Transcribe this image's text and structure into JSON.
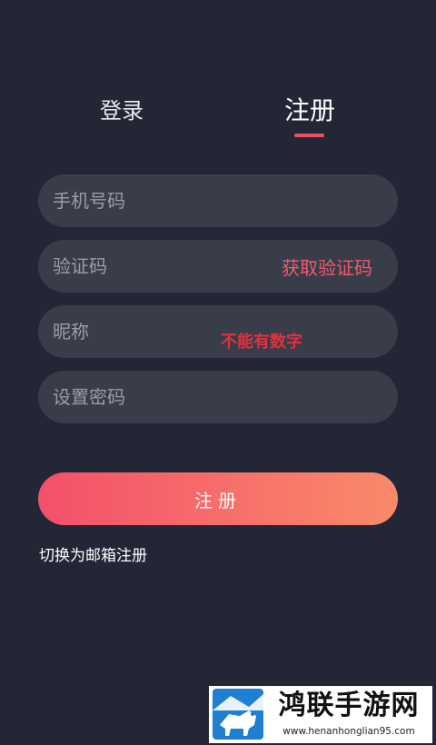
{
  "tabs": {
    "login_label": "登录",
    "register_label": "注册"
  },
  "form": {
    "phone_placeholder": "手机号码",
    "code_placeholder": "验证码",
    "get_code_label": "获取验证码",
    "nickname_placeholder": "昵称",
    "nickname_annotation": "不能有数字",
    "password_placeholder": "设置密码",
    "submit_label": "注册",
    "switch_label": "切换为邮箱注册"
  },
  "watermark": {
    "title": "鸿联手游网",
    "url": "www.henanhonglian95.com"
  },
  "colors": {
    "background": "#232635",
    "field": "#393d4a",
    "accent": "#ef4f63",
    "gradient_start": "#f3506a",
    "gradient_end": "#f88a6a"
  }
}
